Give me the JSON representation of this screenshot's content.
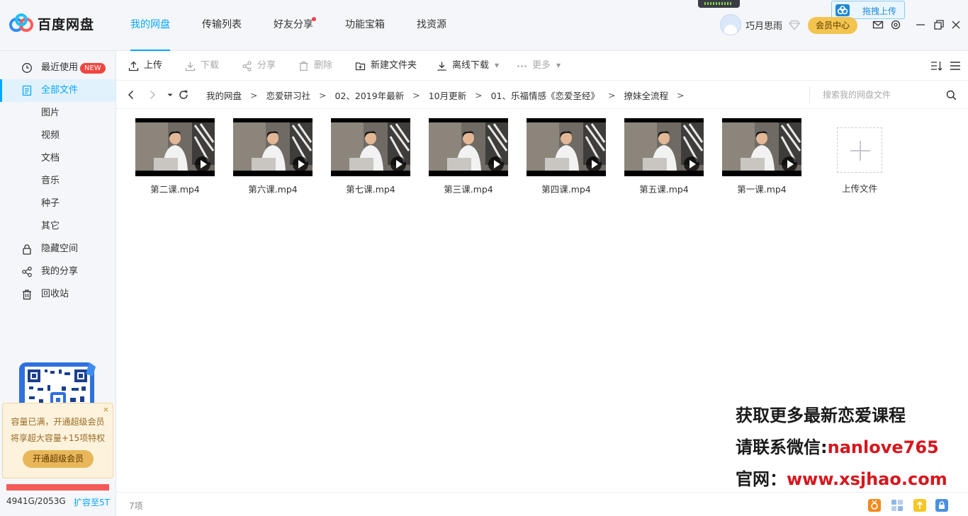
{
  "app": {
    "name": "百度网盘"
  },
  "nav": {
    "tabs": [
      "我的网盘",
      "传输列表",
      "好友分享",
      "功能宝箱",
      "找资源"
    ]
  },
  "user": {
    "name": "巧月思雨",
    "vip_center": "会员中心",
    "drag_upload": "拖拽上传"
  },
  "sidebar": {
    "items": [
      "最近使用",
      "全部文件",
      "图片",
      "视频",
      "文档",
      "音乐",
      "种子",
      "其它",
      "隐藏空间",
      "我的分享",
      "回收站"
    ],
    "new_badge": "NEW",
    "promo_line1": "容量已满，开通超级会员",
    "promo_line2": "将享超大容量+15项特权",
    "promo_button": "开通超级会员",
    "promo_close": "×",
    "quota": "4941G/2053G",
    "expand": "扩容至5T"
  },
  "toolbar": {
    "upload": "上传",
    "download": "下载",
    "share": "分享",
    "delete": "删除",
    "new_folder": "新建文件夹",
    "offline_download": "离线下载",
    "more": "更多"
  },
  "path": {
    "crumbs": [
      "我的网盘",
      "恋爱研习社",
      "02、2019年最新",
      "10月更新",
      "01、乐福情感《恋爱圣经》",
      "撩妹全流程"
    ],
    "sep": ">",
    "search_placeholder": "搜索我的网盘文件"
  },
  "files": [
    "第二课.mp4",
    "第六课.mp4",
    "第七课.mp4",
    "第三课.mp4",
    "第四课.mp4",
    "第五课.mp4",
    "第一课.mp4"
  ],
  "upload_tile": "上传文件",
  "overlay": {
    "line1": "获取更多最新恋爱课程",
    "line2_prefix": "请联系微信:",
    "line2_value": "nanlove765",
    "line3_prefix": "官网：",
    "line3_value": "www.xsjhao.com"
  },
  "status": {
    "count": "7项"
  },
  "colors": {
    "accent": "#06a7ff",
    "vip": "#f3c44f",
    "danger": "#f45b59",
    "overlay_red": "#d6161d"
  }
}
